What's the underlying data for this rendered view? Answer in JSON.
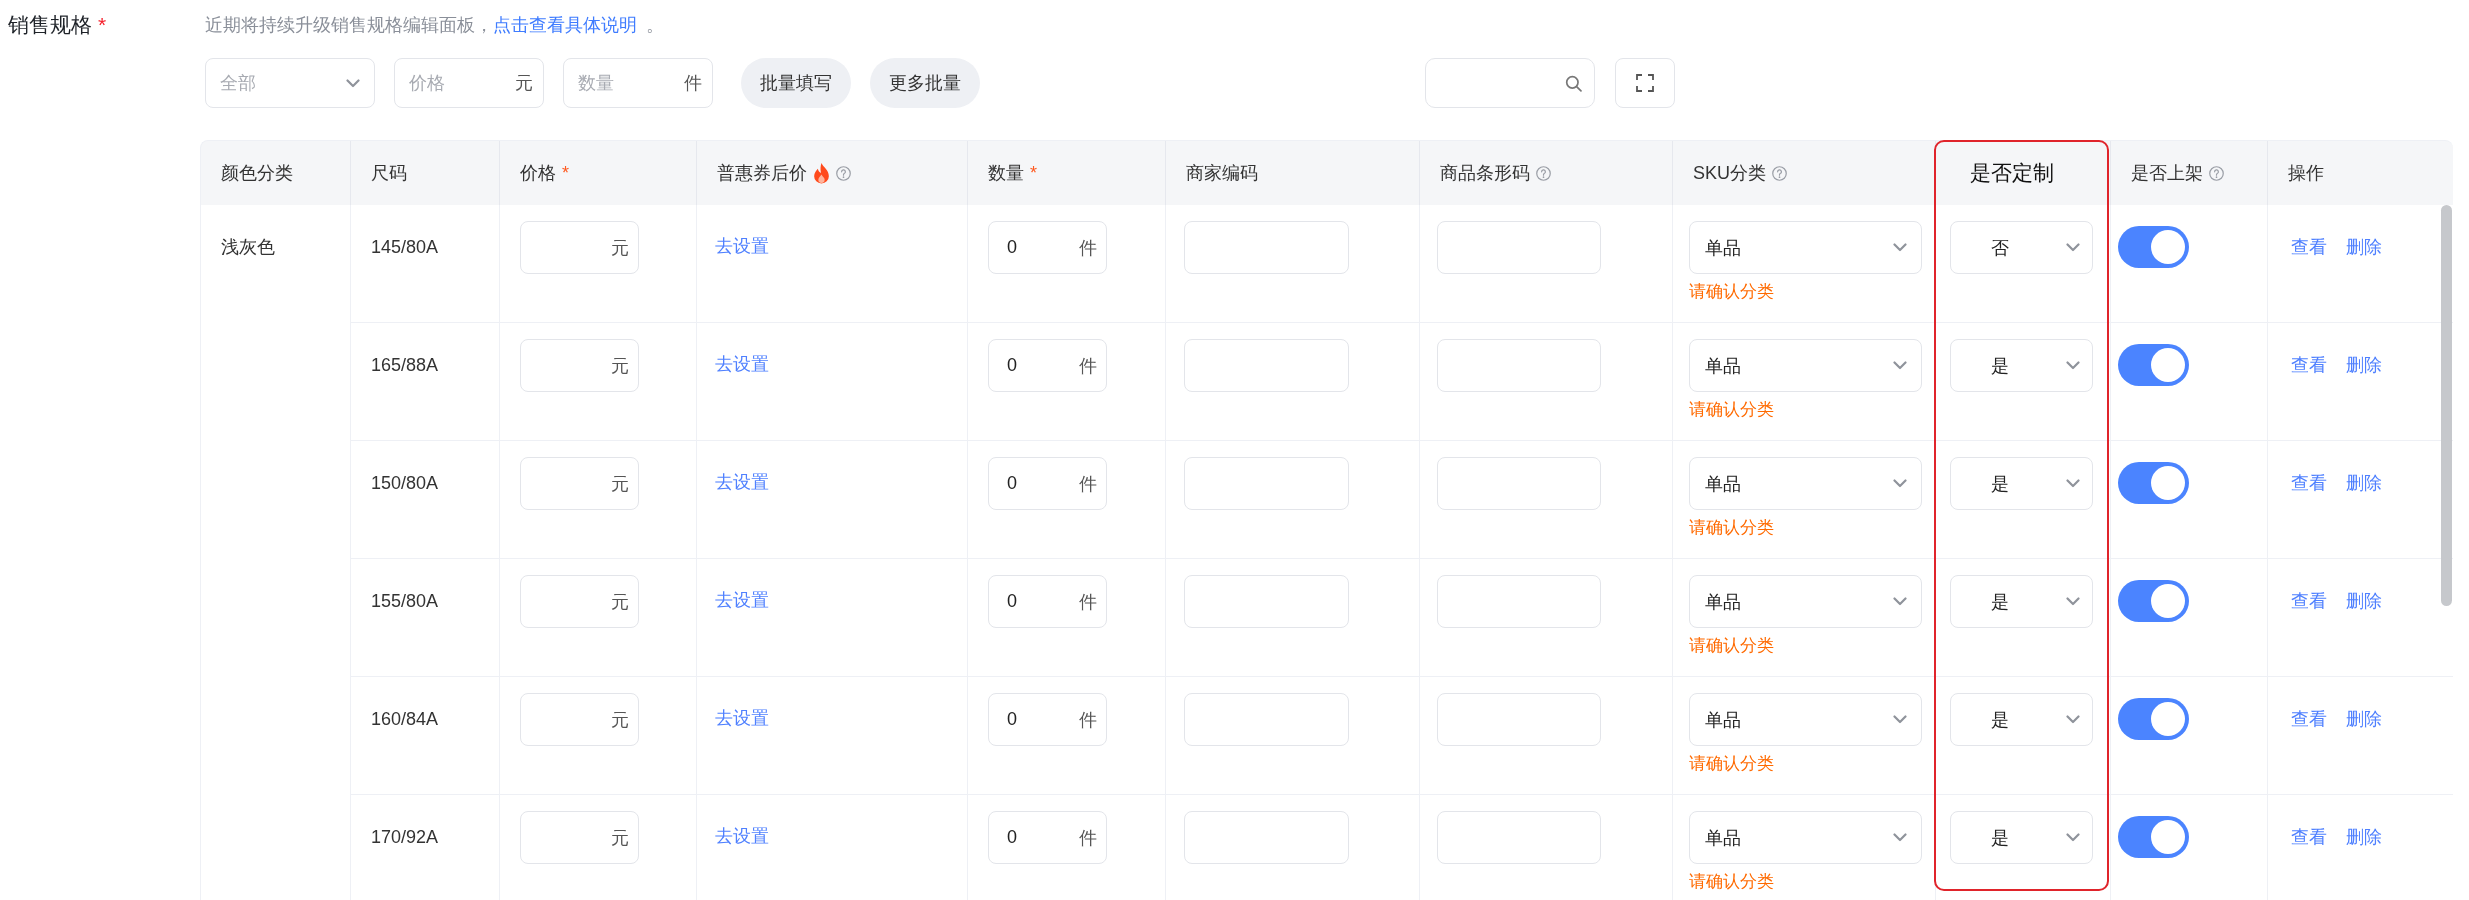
{
  "section": {
    "label": "销售规格",
    "mark": "*"
  },
  "notice": {
    "text": "近期将持续升级销售规格编辑面板，",
    "link": "点击查看具体说明",
    "end": "。"
  },
  "toolbar": {
    "scope": {
      "placeholder": "全部"
    },
    "price": {
      "placeholder": "价格",
      "unit": "元"
    },
    "quantity": {
      "placeholder": "数量",
      "unit": "件"
    },
    "buttons": [
      "批量填写",
      "更多批量"
    ]
  },
  "table": {
    "columns": [
      {
        "kind": "group",
        "label": "颜色分类",
        "highlighted": false
      },
      {
        "kind": "size",
        "label": "尺码",
        "highlighted": false
      },
      {
        "kind": "price",
        "label": "价格",
        "mark": "*",
        "highlighted": false
      },
      {
        "kind": "coupon",
        "label": "普惠券后价",
        "hot": true,
        "help": true,
        "highlighted": false
      },
      {
        "kind": "quantity",
        "label": "数量",
        "mark": "*",
        "highlighted": false
      },
      {
        "kind": "code",
        "label": "商家编码",
        "highlighted": false
      },
      {
        "kind": "barcode",
        "label": "商品条形码",
        "help": true,
        "highlighted": false
      },
      {
        "kind": "category",
        "label": "SKU分类",
        "help": true,
        "highlighted": false
      },
      {
        "kind": "custom",
        "label": "是否定制",
        "highlighted": true
      },
      {
        "kind": "listed",
        "label": "是否上架",
        "help": true,
        "highlighted": false
      },
      {
        "kind": "actions",
        "label": "操作",
        "highlighted": false
      }
    ],
    "group": "浅灰色",
    "rows": [
      {
        "size": "145/80A",
        "price_unit": "元",
        "coupon_link": "去设置",
        "quantity": "0",
        "quantity_unit": "件",
        "sku_category": "单品",
        "sku_warning": "请确认分类",
        "customized": "否",
        "listed": true,
        "actions": [
          "查看",
          "删除"
        ]
      },
      {
        "size": "165/88A",
        "price_unit": "元",
        "coupon_link": "去设置",
        "quantity": "0",
        "quantity_unit": "件",
        "sku_category": "单品",
        "sku_warning": "请确认分类",
        "customized": "是",
        "listed": true,
        "actions": [
          "查看",
          "删除"
        ]
      },
      {
        "size": "150/80A",
        "price_unit": "元",
        "coupon_link": "去设置",
        "quantity": "0",
        "quantity_unit": "件",
        "sku_category": "单品",
        "sku_warning": "请确认分类",
        "customized": "是",
        "listed": true,
        "actions": [
          "查看",
          "删除"
        ]
      },
      {
        "size": "155/80A",
        "price_unit": "元",
        "coupon_link": "去设置",
        "quantity": "0",
        "quantity_unit": "件",
        "sku_category": "单品",
        "sku_warning": "请确认分类",
        "customized": "是",
        "listed": true,
        "actions": [
          "查看",
          "删除"
        ]
      },
      {
        "size": "160/84A",
        "price_unit": "元",
        "coupon_link": "去设置",
        "quantity": "0",
        "quantity_unit": "件",
        "sku_category": "单品",
        "sku_warning": "请确认分类",
        "customized": "是",
        "listed": true,
        "actions": [
          "查看",
          "删除"
        ]
      },
      {
        "size": "170/92A",
        "price_unit": "元",
        "coupon_link": "去设置",
        "quantity": "0",
        "quantity_unit": "件",
        "sku_category": "单品",
        "sku_warning": "请确认分类",
        "customized": "是",
        "listed": true,
        "actions": [
          "查看",
          "删除"
        ]
      }
    ]
  }
}
